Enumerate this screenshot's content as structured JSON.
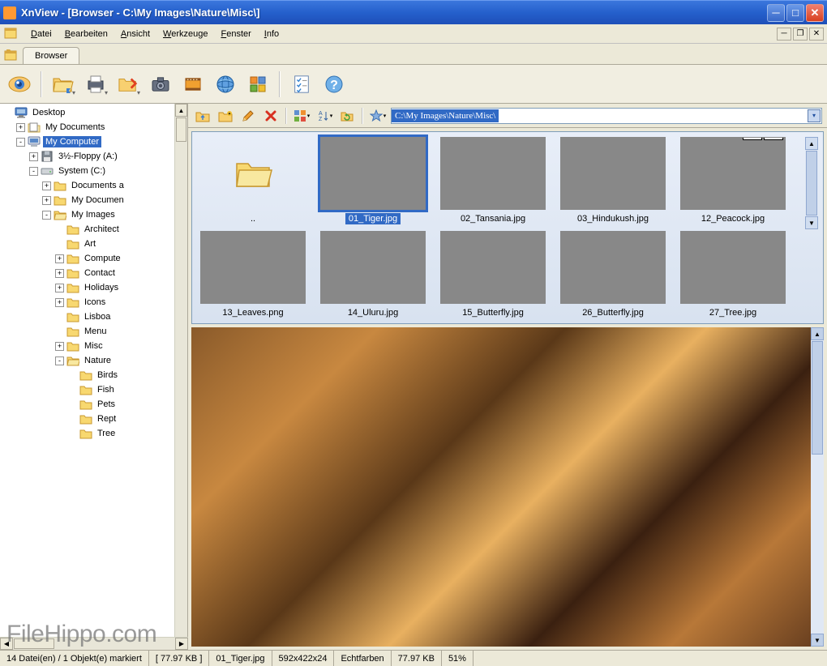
{
  "window": {
    "title": "XnView - [Browser - C:\\My Images\\Nature\\Misc\\]"
  },
  "menu": {
    "items": [
      {
        "u": "D",
        "rest": "atei"
      },
      {
        "u": "B",
        "rest": "earbeiten"
      },
      {
        "u": "A",
        "rest": "nsicht"
      },
      {
        "u": "W",
        "rest": "erkzeuge"
      },
      {
        "u": "F",
        "rest": "enster"
      },
      {
        "u": "I",
        "rest": "nfo"
      }
    ]
  },
  "tab": {
    "label": "Browser"
  },
  "address": {
    "path": "C:\\My Images\\Nature\\Misc\\"
  },
  "tree": [
    {
      "indent": 0,
      "exp": "",
      "icon": "desktop",
      "label": "Desktop"
    },
    {
      "indent": 1,
      "exp": "+",
      "icon": "mydocs",
      "label": "My Documents"
    },
    {
      "indent": 1,
      "exp": "-",
      "icon": "computer",
      "label": "My Computer",
      "selected": true
    },
    {
      "indent": 2,
      "exp": "+",
      "icon": "floppy",
      "label": "3½-Floppy (A:)"
    },
    {
      "indent": 2,
      "exp": "-",
      "icon": "drive",
      "label": "System (C:)"
    },
    {
      "indent": 3,
      "exp": "+",
      "icon": "folder",
      "label": "Documents a"
    },
    {
      "indent": 3,
      "exp": "+",
      "icon": "folder",
      "label": "My Documen"
    },
    {
      "indent": 3,
      "exp": "-",
      "icon": "folder-open",
      "label": "My Images"
    },
    {
      "indent": 4,
      "exp": "",
      "icon": "folder",
      "label": "Architect"
    },
    {
      "indent": 4,
      "exp": "",
      "icon": "folder",
      "label": "Art"
    },
    {
      "indent": 4,
      "exp": "+",
      "icon": "folder",
      "label": "Compute"
    },
    {
      "indent": 4,
      "exp": "+",
      "icon": "folder",
      "label": "Contact"
    },
    {
      "indent": 4,
      "exp": "+",
      "icon": "folder",
      "label": "Holidays"
    },
    {
      "indent": 4,
      "exp": "+",
      "icon": "folder",
      "label": "Icons"
    },
    {
      "indent": 4,
      "exp": "",
      "icon": "folder",
      "label": "Lisboa"
    },
    {
      "indent": 4,
      "exp": "",
      "icon": "folder",
      "label": "Menu"
    },
    {
      "indent": 4,
      "exp": "+",
      "icon": "folder",
      "label": "Misc"
    },
    {
      "indent": 4,
      "exp": "-",
      "icon": "folder-open",
      "label": "Nature"
    },
    {
      "indent": 5,
      "exp": "",
      "icon": "folder",
      "label": "Birds"
    },
    {
      "indent": 5,
      "exp": "",
      "icon": "folder",
      "label": "Fish"
    },
    {
      "indent": 5,
      "exp": "",
      "icon": "folder",
      "label": "Pets"
    },
    {
      "indent": 5,
      "exp": "",
      "icon": "folder",
      "label": "Rept"
    },
    {
      "indent": 5,
      "exp": "",
      "icon": "folder",
      "label": "Tree"
    }
  ],
  "thumbnails": [
    {
      "type": "folder",
      "label": "..",
      "img": ""
    },
    {
      "type": "image",
      "label": "01_Tiger.jpg",
      "img": "img-tiger",
      "selected": true
    },
    {
      "type": "image",
      "label": "02_Tansania.jpg",
      "img": "img-tansania"
    },
    {
      "type": "image",
      "label": "03_Hindukush.jpg",
      "img": "img-hindukush"
    },
    {
      "type": "image",
      "label": "12_Peacock.jpg",
      "img": "img-peacock",
      "badges": [
        "EXIF",
        "IPTC"
      ]
    },
    {
      "type": "image",
      "label": "13_Leaves.png",
      "img": "img-leaves"
    },
    {
      "type": "image",
      "label": "14_Uluru.jpg",
      "img": "img-uluru"
    },
    {
      "type": "image",
      "label": "15_Butterfly.jpg",
      "img": "img-butterfly1"
    },
    {
      "type": "image",
      "label": "26_Butterfly.jpg",
      "img": "img-butterfly2"
    },
    {
      "type": "image",
      "label": "27_Tree.jpg",
      "img": "img-tree"
    }
  ],
  "status": {
    "count": "14 Datei(en) / 1 Objekt(e) markiert",
    "size1": "[ 77.97 KB ]",
    "filename": "01_Tiger.jpg",
    "dims": "592x422x24",
    "colormode": "Echtfarben",
    "size2": "77.97 KB",
    "zoom": "51%"
  },
  "watermark": "FileHippo.com"
}
